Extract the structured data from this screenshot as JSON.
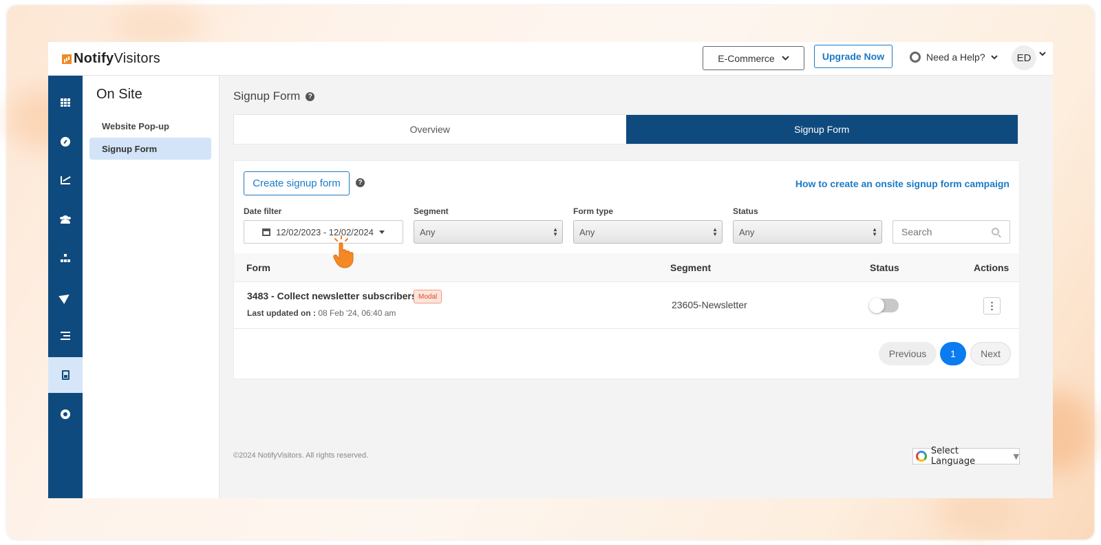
{
  "header": {
    "logo_text_bold": "Notify",
    "logo_text": "Visitors",
    "account_select": "E-Commerce",
    "upgrade_label": "Upgrade Now",
    "help_label": "Need a Help?",
    "avatar_initials": "ED"
  },
  "rail": {
    "icons": [
      "apps-grid-icon",
      "dashboard-gauge-icon",
      "analytics-chart-icon",
      "audience-users-icon",
      "sitemap-icon",
      "send-icon",
      "list-icon",
      "signup-form-doc-icon",
      "settings-gear-icon"
    ],
    "active_index": 7
  },
  "subnav": {
    "title": "On Site",
    "items": [
      {
        "label": "Website Pop-up",
        "active": false
      },
      {
        "label": "Signup Form",
        "active": true
      }
    ]
  },
  "page": {
    "title": "Signup Form",
    "tabs": [
      {
        "label": "Overview",
        "active": false
      },
      {
        "label": "Signup Form",
        "active": true
      }
    ]
  },
  "toolbar": {
    "create_label": "Create signup form",
    "howto_link": "How to create an onsite signup form campaign"
  },
  "filters": {
    "date_label": "Date filter",
    "date_value": "12/02/2023 - 12/02/2024",
    "segment_label": "Segment",
    "segment_value": "Any",
    "formtype_label": "Form type",
    "formtype_value": "Any",
    "status_label": "Status",
    "status_value": "Any",
    "search_placeholder": "Search"
  },
  "table": {
    "columns": [
      "Form",
      "Segment",
      "Status",
      "Actions"
    ],
    "rows": [
      {
        "name": "3483 - Collect newsletter subscribers",
        "badge": "Modal",
        "updated_label": "Last updated on :",
        "updated_value": "08 Feb '24, 06:40 am",
        "segment": "23605-Newsletter",
        "status_on": false,
        "actions_glyph": "⋮"
      }
    ]
  },
  "pagination": {
    "prev": "Previous",
    "current": "1",
    "next": "Next"
  },
  "footer": {
    "copyright": "©2024 NotifyVisitors. All rights reserved.",
    "language_label": "Select Language",
    "language_caret": "▼"
  },
  "colors": {
    "brand_navy": "#0f4a7e",
    "accent_blue": "#1b7ac6",
    "page_active": "#0a7cf0",
    "badge": "#d3502b",
    "logo_orange": "#f08a24"
  }
}
